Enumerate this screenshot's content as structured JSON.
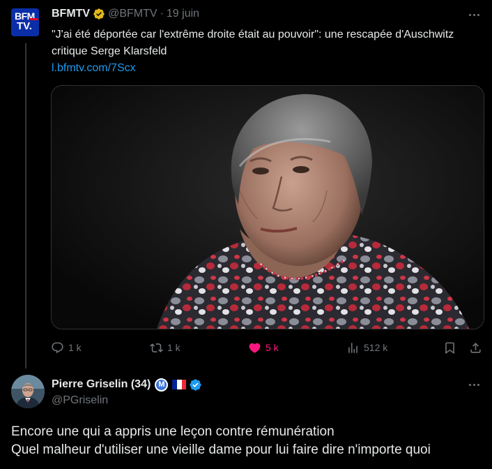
{
  "tweet": {
    "avatar_lines": [
      "BFM",
      "TV."
    ],
    "author_name": "BFMTV",
    "author_handle": "@BFMTV",
    "separator": "·",
    "date": "19 juin",
    "text": "\"J'ai été déportée car l'extrême droite était au pouvoir\": une rescapée d'Auschwitz critique Serge Klarsfeld",
    "link": "l.bfmtv.com/7Scx",
    "image_icon": "photo-portrait-elderly-woman",
    "actions": {
      "replies": "1 k",
      "reposts": "1 k",
      "likes": "5 k",
      "views": "512 k"
    }
  },
  "reply": {
    "author_name": "Pierre Griselin (34)",
    "author_handle": "@PGriselin",
    "text_lines": [
      "Encore une qui a appris une leçon contre rémunération",
      "Quel malheur d'utiliser une vieille dame pour lui faire dire n'importe quoi"
    ],
    "badge_letter": "M"
  },
  "colors": {
    "background": "#000000",
    "text": "#e7e9ea",
    "muted": "#71767b",
    "link": "#1d9bf0",
    "like": "#f91880",
    "gold_badge": "#e2b719",
    "blue_badge": "#1d9bf0",
    "bfm_blue": "#0a2ea8"
  }
}
